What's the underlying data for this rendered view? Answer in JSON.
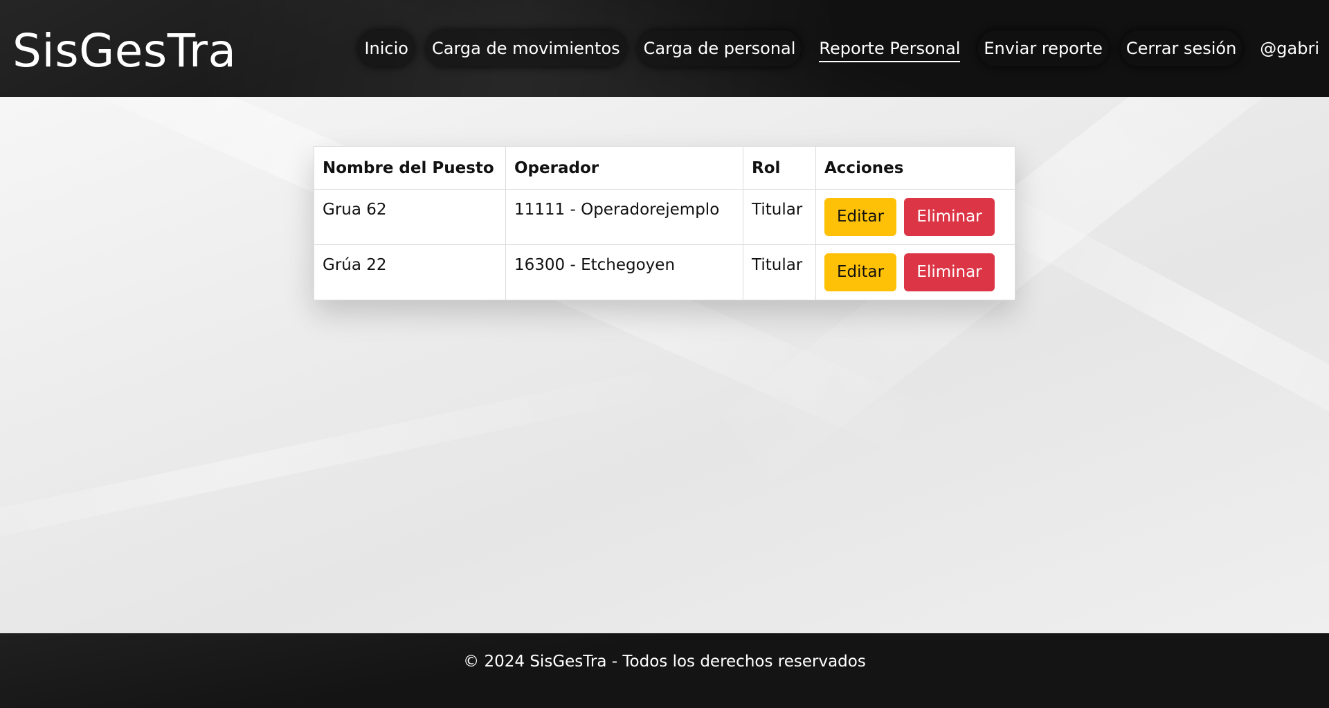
{
  "app": {
    "brand": "SisGesTra"
  },
  "nav": {
    "items": [
      {
        "label": "Inicio"
      },
      {
        "label": "Carga de movimientos"
      },
      {
        "label": "Carga de personal"
      },
      {
        "label": "Reporte Personal",
        "active": true
      },
      {
        "label": "Enviar reporte"
      },
      {
        "label": "Cerrar sesión"
      },
      {
        "label": "@gabri"
      }
    ]
  },
  "table": {
    "headers": [
      "Nombre del Puesto",
      "Operador",
      "Rol",
      "Acciones"
    ],
    "rows": [
      {
        "puesto": "Grua 62",
        "operador": "11111 - Operadorejemplo",
        "rol": "Titular",
        "edit": "Editar",
        "delete": "Eliminar"
      },
      {
        "puesto": "Grúa 22",
        "operador": "16300 - Etchegoyen",
        "rol": "Titular",
        "edit": "Editar",
        "delete": "Eliminar"
      }
    ]
  },
  "footer": {
    "text": "© 2024 SisGesTra - Todos los derechos reservados"
  },
  "colors": {
    "header_bg": "#111111",
    "edit_button": "#ffc107",
    "delete_button": "#dc3545"
  }
}
